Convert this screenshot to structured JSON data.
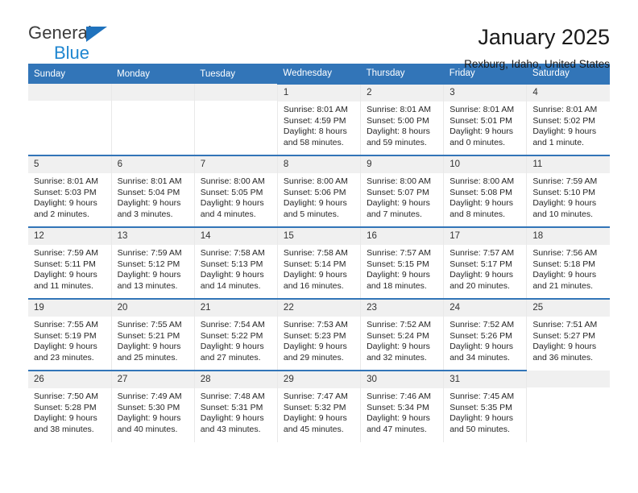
{
  "brand": {
    "name_part1": "General",
    "name_part2": "Blue",
    "triangle_color": "#1f72bd",
    "blue_text_color": "#1f86d0"
  },
  "header": {
    "title": "January 2025",
    "location": "Rexburg, Idaho, United States"
  },
  "theme": {
    "header_blue": "#3275b8",
    "daynum_gray": "#f0f0f0",
    "text_color": "#262626"
  },
  "weekdays": [
    "Sunday",
    "Monday",
    "Tuesday",
    "Wednesday",
    "Thursday",
    "Friday",
    "Saturday"
  ],
  "weeks": [
    [
      {
        "day": "",
        "empty": true
      },
      {
        "day": "",
        "empty": true
      },
      {
        "day": "",
        "empty": true
      },
      {
        "day": "1",
        "sunrise": "Sunrise: 8:01 AM",
        "sunset": "Sunset: 4:59 PM",
        "daylight1": "Daylight: 8 hours",
        "daylight2": "and 58 minutes."
      },
      {
        "day": "2",
        "sunrise": "Sunrise: 8:01 AM",
        "sunset": "Sunset: 5:00 PM",
        "daylight1": "Daylight: 8 hours",
        "daylight2": "and 59 minutes."
      },
      {
        "day": "3",
        "sunrise": "Sunrise: 8:01 AM",
        "sunset": "Sunset: 5:01 PM",
        "daylight1": "Daylight: 9 hours",
        "daylight2": "and 0 minutes."
      },
      {
        "day": "4",
        "sunrise": "Sunrise: 8:01 AM",
        "sunset": "Sunset: 5:02 PM",
        "daylight1": "Daylight: 9 hours",
        "daylight2": "and 1 minute."
      }
    ],
    [
      {
        "day": "5",
        "sunrise": "Sunrise: 8:01 AM",
        "sunset": "Sunset: 5:03 PM",
        "daylight1": "Daylight: 9 hours",
        "daylight2": "and 2 minutes."
      },
      {
        "day": "6",
        "sunrise": "Sunrise: 8:01 AM",
        "sunset": "Sunset: 5:04 PM",
        "daylight1": "Daylight: 9 hours",
        "daylight2": "and 3 minutes."
      },
      {
        "day": "7",
        "sunrise": "Sunrise: 8:00 AM",
        "sunset": "Sunset: 5:05 PM",
        "daylight1": "Daylight: 9 hours",
        "daylight2": "and 4 minutes."
      },
      {
        "day": "8",
        "sunrise": "Sunrise: 8:00 AM",
        "sunset": "Sunset: 5:06 PM",
        "daylight1": "Daylight: 9 hours",
        "daylight2": "and 5 minutes."
      },
      {
        "day": "9",
        "sunrise": "Sunrise: 8:00 AM",
        "sunset": "Sunset: 5:07 PM",
        "daylight1": "Daylight: 9 hours",
        "daylight2": "and 7 minutes."
      },
      {
        "day": "10",
        "sunrise": "Sunrise: 8:00 AM",
        "sunset": "Sunset: 5:08 PM",
        "daylight1": "Daylight: 9 hours",
        "daylight2": "and 8 minutes."
      },
      {
        "day": "11",
        "sunrise": "Sunrise: 7:59 AM",
        "sunset": "Sunset: 5:10 PM",
        "daylight1": "Daylight: 9 hours",
        "daylight2": "and 10 minutes."
      }
    ],
    [
      {
        "day": "12",
        "sunrise": "Sunrise: 7:59 AM",
        "sunset": "Sunset: 5:11 PM",
        "daylight1": "Daylight: 9 hours",
        "daylight2": "and 11 minutes."
      },
      {
        "day": "13",
        "sunrise": "Sunrise: 7:59 AM",
        "sunset": "Sunset: 5:12 PM",
        "daylight1": "Daylight: 9 hours",
        "daylight2": "and 13 minutes."
      },
      {
        "day": "14",
        "sunrise": "Sunrise: 7:58 AM",
        "sunset": "Sunset: 5:13 PM",
        "daylight1": "Daylight: 9 hours",
        "daylight2": "and 14 minutes."
      },
      {
        "day": "15",
        "sunrise": "Sunrise: 7:58 AM",
        "sunset": "Sunset: 5:14 PM",
        "daylight1": "Daylight: 9 hours",
        "daylight2": "and 16 minutes."
      },
      {
        "day": "16",
        "sunrise": "Sunrise: 7:57 AM",
        "sunset": "Sunset: 5:15 PM",
        "daylight1": "Daylight: 9 hours",
        "daylight2": "and 18 minutes."
      },
      {
        "day": "17",
        "sunrise": "Sunrise: 7:57 AM",
        "sunset": "Sunset: 5:17 PM",
        "daylight1": "Daylight: 9 hours",
        "daylight2": "and 20 minutes."
      },
      {
        "day": "18",
        "sunrise": "Sunrise: 7:56 AM",
        "sunset": "Sunset: 5:18 PM",
        "daylight1": "Daylight: 9 hours",
        "daylight2": "and 21 minutes."
      }
    ],
    [
      {
        "day": "19",
        "sunrise": "Sunrise: 7:55 AM",
        "sunset": "Sunset: 5:19 PM",
        "daylight1": "Daylight: 9 hours",
        "daylight2": "and 23 minutes."
      },
      {
        "day": "20",
        "sunrise": "Sunrise: 7:55 AM",
        "sunset": "Sunset: 5:21 PM",
        "daylight1": "Daylight: 9 hours",
        "daylight2": "and 25 minutes."
      },
      {
        "day": "21",
        "sunrise": "Sunrise: 7:54 AM",
        "sunset": "Sunset: 5:22 PM",
        "daylight1": "Daylight: 9 hours",
        "daylight2": "and 27 minutes."
      },
      {
        "day": "22",
        "sunrise": "Sunrise: 7:53 AM",
        "sunset": "Sunset: 5:23 PM",
        "daylight1": "Daylight: 9 hours",
        "daylight2": "and 29 minutes."
      },
      {
        "day": "23",
        "sunrise": "Sunrise: 7:52 AM",
        "sunset": "Sunset: 5:24 PM",
        "daylight1": "Daylight: 9 hours",
        "daylight2": "and 32 minutes."
      },
      {
        "day": "24",
        "sunrise": "Sunrise: 7:52 AM",
        "sunset": "Sunset: 5:26 PM",
        "daylight1": "Daylight: 9 hours",
        "daylight2": "and 34 minutes."
      },
      {
        "day": "25",
        "sunrise": "Sunrise: 7:51 AM",
        "sunset": "Sunset: 5:27 PM",
        "daylight1": "Daylight: 9 hours",
        "daylight2": "and 36 minutes."
      }
    ],
    [
      {
        "day": "26",
        "sunrise": "Sunrise: 7:50 AM",
        "sunset": "Sunset: 5:28 PM",
        "daylight1": "Daylight: 9 hours",
        "daylight2": "and 38 minutes."
      },
      {
        "day": "27",
        "sunrise": "Sunrise: 7:49 AM",
        "sunset": "Sunset: 5:30 PM",
        "daylight1": "Daylight: 9 hours",
        "daylight2": "and 40 minutes."
      },
      {
        "day": "28",
        "sunrise": "Sunrise: 7:48 AM",
        "sunset": "Sunset: 5:31 PM",
        "daylight1": "Daylight: 9 hours",
        "daylight2": "and 43 minutes."
      },
      {
        "day": "29",
        "sunrise": "Sunrise: 7:47 AM",
        "sunset": "Sunset: 5:32 PM",
        "daylight1": "Daylight: 9 hours",
        "daylight2": "and 45 minutes."
      },
      {
        "day": "30",
        "sunrise": "Sunrise: 7:46 AM",
        "sunset": "Sunset: 5:34 PM",
        "daylight1": "Daylight: 9 hours",
        "daylight2": "and 47 minutes."
      },
      {
        "day": "31",
        "sunrise": "Sunrise: 7:45 AM",
        "sunset": "Sunset: 5:35 PM",
        "daylight1": "Daylight: 9 hours",
        "daylight2": "and 50 minutes."
      },
      {
        "day": "",
        "empty": true
      }
    ]
  ]
}
